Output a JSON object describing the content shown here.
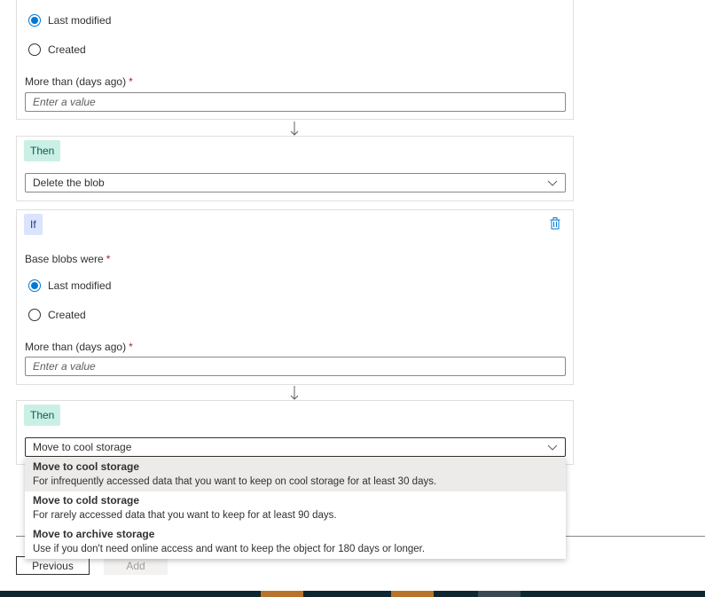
{
  "rule1": {
    "radio_last_modified": "Last modified",
    "radio_created": "Created",
    "days_label": "More than (days ago)",
    "required_mark": "*",
    "days_placeholder": "Enter a value"
  },
  "then1": {
    "badge": "Then",
    "action_value": "Delete the blob"
  },
  "if2": {
    "badge": "If",
    "base_blobs_label": "Base blobs were",
    "required_mark": "*",
    "radio_last_modified": "Last modified",
    "radio_created": "Created",
    "days_label": "More than (days ago)",
    "days_placeholder": "Enter a value"
  },
  "then2": {
    "badge": "Then",
    "action_value": "Move to cool storage"
  },
  "dropdown": {
    "options": [
      {
        "title": "Move to cool storage",
        "desc": "For infrequently accessed data that you want to keep on cool storage for at least 30 days."
      },
      {
        "title": "Move to cold storage",
        "desc": "For rarely accessed data that you want to keep for at least 90 days."
      },
      {
        "title": "Move to archive storage",
        "desc": "Use if you don't need online access and want to keep the object for 180 days or longer."
      }
    ]
  },
  "footer": {
    "previous": "Previous",
    "add": "Add"
  },
  "colors": {
    "accent": "#0078d4",
    "then_badge": "#caf0e6",
    "if_badge": "#dbe4ff",
    "required": "#a4262c",
    "taskbar": "#0e2630"
  }
}
